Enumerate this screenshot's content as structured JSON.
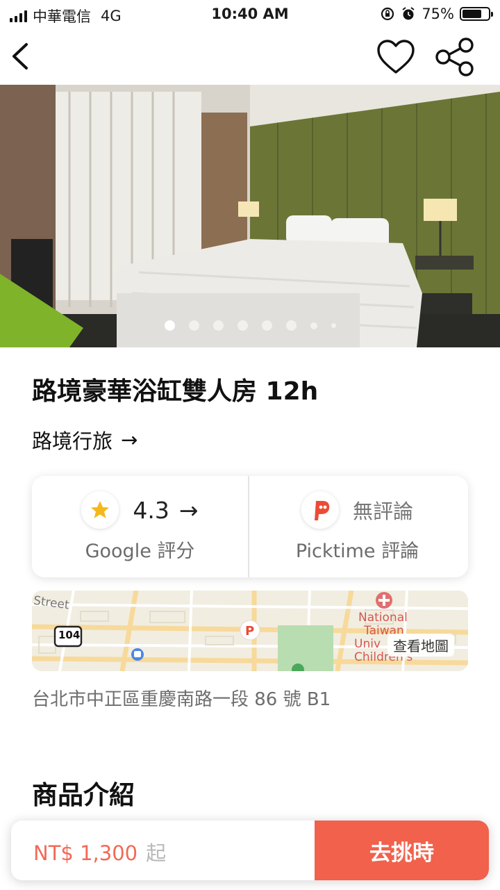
{
  "status_bar": {
    "carrier": "中華電信",
    "network": "4G",
    "time": "10:40 AM",
    "battery": "75%",
    "battery_level": 0.75
  },
  "hero": {
    "slide_count": 8,
    "active_slide": 1
  },
  "product": {
    "title": "路境豪華浴缸雙人房 12h",
    "brand": "路境行旅",
    "arrow": "→"
  },
  "ratings": {
    "google": {
      "score": "4.3",
      "arrow": "→",
      "label": "Google 評分"
    },
    "picktime": {
      "status": "無評論",
      "label": "Picktime 評論"
    }
  },
  "map": {
    "button": "查看地圖",
    "labels": {
      "street": "Street",
      "route": "104",
      "poi_line1": "National",
      "poi_line2": "Taiwan",
      "poi_line3": "Univ",
      "poi_line4": "Children's"
    }
  },
  "address": "台北市中正區重慶南路一段 86 號 B1",
  "section": {
    "intro_title": "商品介紹"
  },
  "bottom_bar": {
    "price": "NT$ 1,300",
    "price_suffix": "起",
    "cta": "去挑時"
  },
  "colors": {
    "accent": "#f1614c",
    "price": "#f26a55",
    "star": "#f5b81c"
  }
}
